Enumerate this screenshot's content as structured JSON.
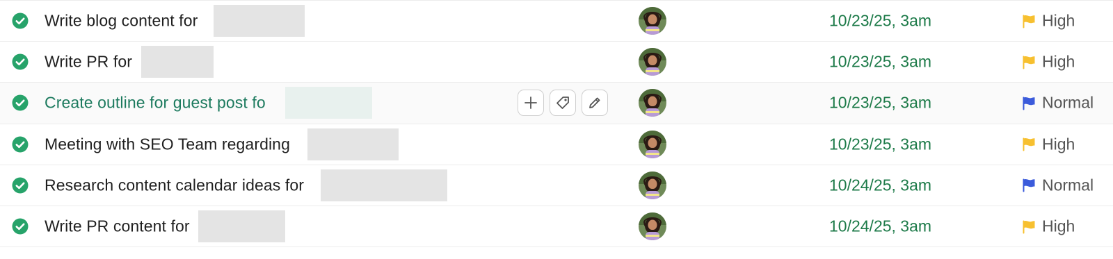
{
  "colors": {
    "check": "#27a36a",
    "date": "#1c7a48",
    "high_flag": "#f7c030",
    "normal_flag": "#3b5bdb",
    "hover_title": "#1c7a5e"
  },
  "icons": {
    "status": "check-circle-icon",
    "assignee": "avatar",
    "add": "plus-icon",
    "tag": "tag-icon",
    "edit": "pencil-icon",
    "priority": "flag-icon"
  },
  "tasks": [
    {
      "title": "Write blog content for",
      "date": "10/23/25, 3am",
      "priority": "High"
    },
    {
      "title": "Write PR for",
      "date": "10/23/25, 3am",
      "priority": "High"
    },
    {
      "title": "Create outline for guest post fo",
      "date": "10/23/25, 3am",
      "priority": "Normal"
    },
    {
      "title": "Meeting with SEO Team regarding",
      "date": "10/23/25, 3am",
      "priority": "High"
    },
    {
      "title": "Research content calendar ideas for",
      "date": "10/24/25, 3am",
      "priority": "Normal"
    },
    {
      "title": "Write PR content for",
      "date": "10/24/25, 3am",
      "priority": "High"
    }
  ]
}
